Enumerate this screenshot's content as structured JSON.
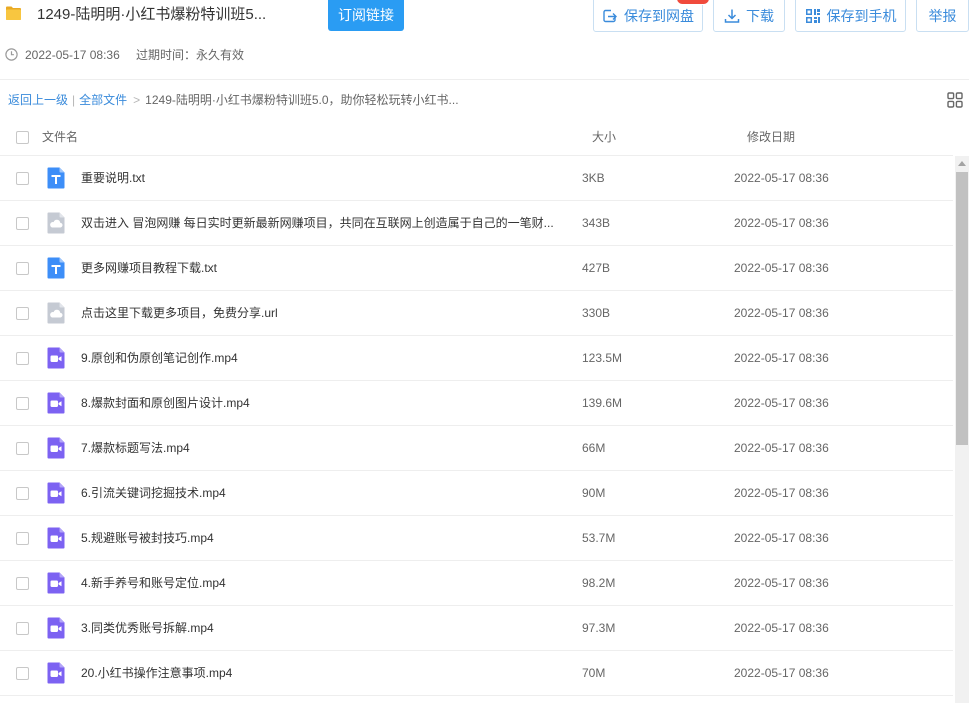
{
  "colors": {
    "accent": "#2a9cf3",
    "link": "#3a8bdb",
    "txt_icon": "#3d8ef8",
    "video_icon": "#7c62f2",
    "link_icon": "#c5cad3",
    "badge": "#f04a3c"
  },
  "header": {
    "folder_icon": "folder-icon",
    "title": "1249-陆明明·小红书爆粉特训班5...",
    "subscribe_label": "订阅链接",
    "actions": {
      "save_to_cloud": {
        "label": "保存到网盘",
        "icon": "save-to-cloud-icon"
      },
      "download": {
        "label": "下载",
        "icon": "download-icon"
      },
      "save_to_phone": {
        "label": "保存到手机",
        "icon": "qr-code-icon"
      },
      "report": {
        "label": "举报"
      }
    }
  },
  "meta": {
    "icon": "clock-icon",
    "created": "2022-05-17 08:36",
    "expiry": "过期时间：永久有效"
  },
  "breadcrumb": {
    "back": "返回上一级",
    "divider": "|",
    "all_files": "全部文件",
    "separator": ">",
    "current": "1249-陆明明·小红书爆粉特训班5.0，助你轻松玩转小红书..."
  },
  "view_toggle": {
    "icon": "grid-view-icon"
  },
  "table": {
    "columns": {
      "name": "文件名",
      "size": "大小",
      "modified": "修改日期"
    },
    "rows": [
      {
        "icon": "txt-file-icon",
        "name": "重要说明.txt",
        "size": "3KB",
        "modified": "2022-05-17 08:36"
      },
      {
        "icon": "link-file-icon",
        "name": "双击进入 冒泡网赚 每日实时更新最新网赚项目，共同在互联网上创造属于自己的一笔财...",
        "size": "343B",
        "modified": "2022-05-17 08:36"
      },
      {
        "icon": "txt-file-icon",
        "name": "更多网赚项目教程下载.txt",
        "size": "427B",
        "modified": "2022-05-17 08:36"
      },
      {
        "icon": "link-file-icon",
        "name": "点击这里下载更多项目，免费分享.url",
        "size": "330B",
        "modified": "2022-05-17 08:36"
      },
      {
        "icon": "video-file-icon",
        "name": "9.原创和伪原创笔记创作.mp4",
        "size": "123.5M",
        "modified": "2022-05-17 08:36"
      },
      {
        "icon": "video-file-icon",
        "name": "8.爆款封面和原创图片设计.mp4",
        "size": "139.6M",
        "modified": "2022-05-17 08:36"
      },
      {
        "icon": "video-file-icon",
        "name": "7.爆款标题写法.mp4",
        "size": "66M",
        "modified": "2022-05-17 08:36"
      },
      {
        "icon": "video-file-icon",
        "name": "6.引流关键词挖掘技术.mp4",
        "size": "90M",
        "modified": "2022-05-17 08:36"
      },
      {
        "icon": "video-file-icon",
        "name": "5.规避账号被封技巧.mp4",
        "size": "53.7M",
        "modified": "2022-05-17 08:36"
      },
      {
        "icon": "video-file-icon",
        "name": "4.新手养号和账号定位.mp4",
        "size": "98.2M",
        "modified": "2022-05-17 08:36"
      },
      {
        "icon": "video-file-icon",
        "name": "3.同类优秀账号拆解.mp4",
        "size": "97.3M",
        "modified": "2022-05-17 08:36"
      },
      {
        "icon": "video-file-icon",
        "name": "20.小红书操作注意事项.mp4",
        "size": "70M",
        "modified": "2022-05-17 08:36"
      }
    ]
  }
}
